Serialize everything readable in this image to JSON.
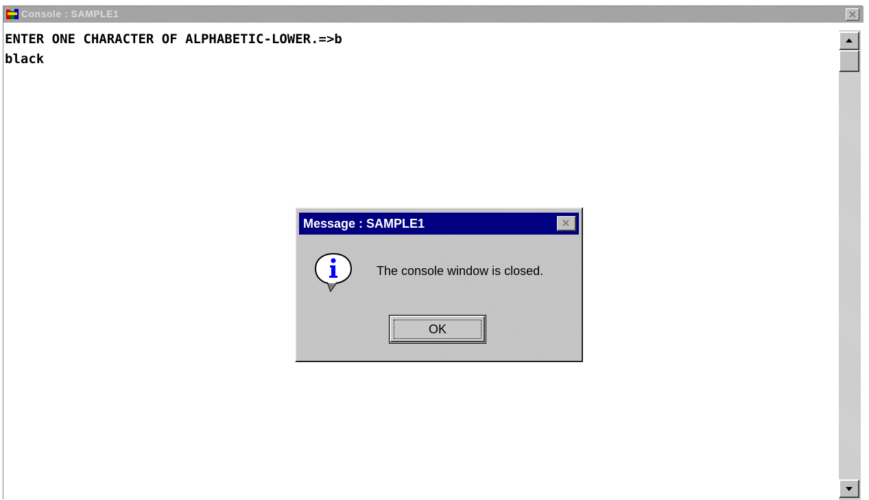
{
  "console": {
    "title": "Console : SAMPLE1",
    "lines": [
      "ENTER ONE CHARACTER OF ALPHABETIC-LOWER.=>b",
      "black"
    ],
    "icons": {
      "app": "application-icon",
      "close": "close-icon",
      "scroll_up": "arrow-up-icon",
      "scroll_down": "arrow-down-icon"
    },
    "colors": {
      "titlebar_inactive": "#a8a8a8",
      "title_text": "#dcdcdc",
      "background": "#ffffff"
    }
  },
  "dialog": {
    "title": "Message : SAMPLE1",
    "message": "The console window is closed.",
    "ok_label": "OK",
    "icons": {
      "info": "information-icon",
      "close": "close-icon"
    },
    "colors": {
      "titlebar_active": "#000080",
      "face": "#c8c8c8",
      "info_glyph": "#0000ff"
    }
  }
}
